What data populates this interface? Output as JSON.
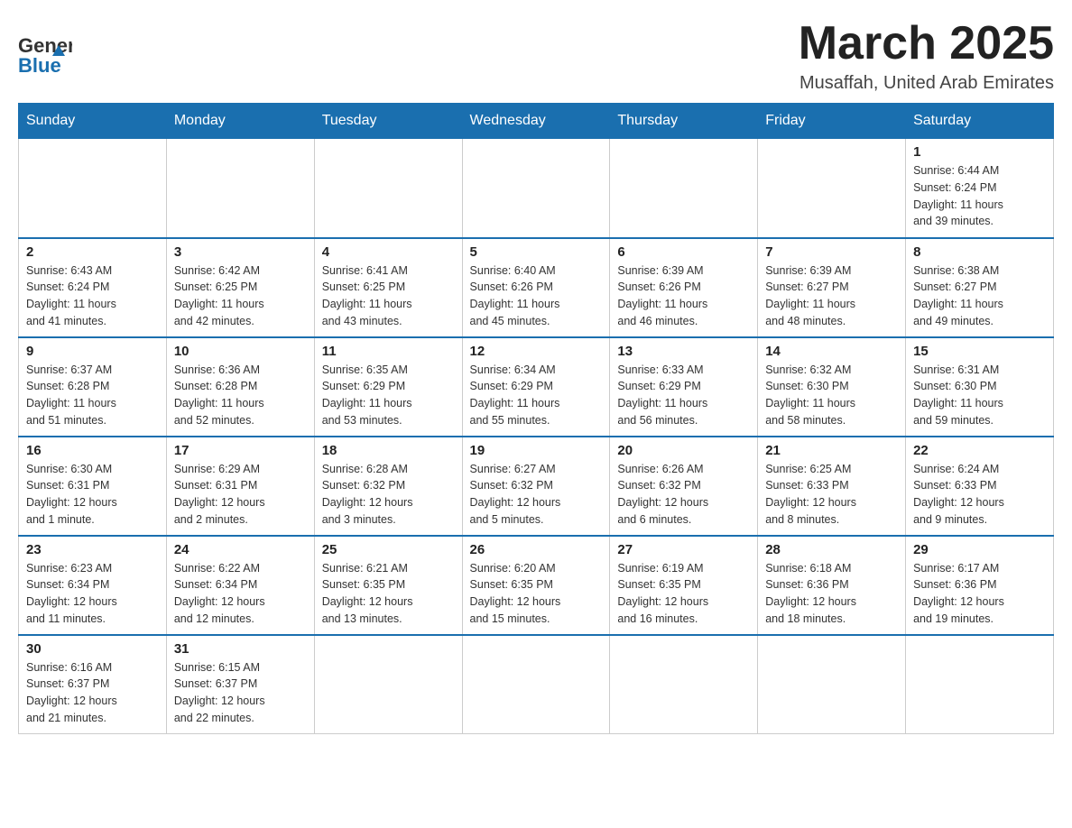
{
  "header": {
    "logo_line1": "General",
    "logo_line2": "Blue",
    "month_title": "March 2025",
    "location": "Musaffah, United Arab Emirates"
  },
  "days_of_week": [
    "Sunday",
    "Monday",
    "Tuesday",
    "Wednesday",
    "Thursday",
    "Friday",
    "Saturday"
  ],
  "weeks": [
    [
      {
        "day": "",
        "info": ""
      },
      {
        "day": "",
        "info": ""
      },
      {
        "day": "",
        "info": ""
      },
      {
        "day": "",
        "info": ""
      },
      {
        "day": "",
        "info": ""
      },
      {
        "day": "",
        "info": ""
      },
      {
        "day": "1",
        "info": "Sunrise: 6:44 AM\nSunset: 6:24 PM\nDaylight: 11 hours\nand 39 minutes."
      }
    ],
    [
      {
        "day": "2",
        "info": "Sunrise: 6:43 AM\nSunset: 6:24 PM\nDaylight: 11 hours\nand 41 minutes."
      },
      {
        "day": "3",
        "info": "Sunrise: 6:42 AM\nSunset: 6:25 PM\nDaylight: 11 hours\nand 42 minutes."
      },
      {
        "day": "4",
        "info": "Sunrise: 6:41 AM\nSunset: 6:25 PM\nDaylight: 11 hours\nand 43 minutes."
      },
      {
        "day": "5",
        "info": "Sunrise: 6:40 AM\nSunset: 6:26 PM\nDaylight: 11 hours\nand 45 minutes."
      },
      {
        "day": "6",
        "info": "Sunrise: 6:39 AM\nSunset: 6:26 PM\nDaylight: 11 hours\nand 46 minutes."
      },
      {
        "day": "7",
        "info": "Sunrise: 6:39 AM\nSunset: 6:27 PM\nDaylight: 11 hours\nand 48 minutes."
      },
      {
        "day": "8",
        "info": "Sunrise: 6:38 AM\nSunset: 6:27 PM\nDaylight: 11 hours\nand 49 minutes."
      }
    ],
    [
      {
        "day": "9",
        "info": "Sunrise: 6:37 AM\nSunset: 6:28 PM\nDaylight: 11 hours\nand 51 minutes."
      },
      {
        "day": "10",
        "info": "Sunrise: 6:36 AM\nSunset: 6:28 PM\nDaylight: 11 hours\nand 52 minutes."
      },
      {
        "day": "11",
        "info": "Sunrise: 6:35 AM\nSunset: 6:29 PM\nDaylight: 11 hours\nand 53 minutes."
      },
      {
        "day": "12",
        "info": "Sunrise: 6:34 AM\nSunset: 6:29 PM\nDaylight: 11 hours\nand 55 minutes."
      },
      {
        "day": "13",
        "info": "Sunrise: 6:33 AM\nSunset: 6:29 PM\nDaylight: 11 hours\nand 56 minutes."
      },
      {
        "day": "14",
        "info": "Sunrise: 6:32 AM\nSunset: 6:30 PM\nDaylight: 11 hours\nand 58 minutes."
      },
      {
        "day": "15",
        "info": "Sunrise: 6:31 AM\nSunset: 6:30 PM\nDaylight: 11 hours\nand 59 minutes."
      }
    ],
    [
      {
        "day": "16",
        "info": "Sunrise: 6:30 AM\nSunset: 6:31 PM\nDaylight: 12 hours\nand 1 minute."
      },
      {
        "day": "17",
        "info": "Sunrise: 6:29 AM\nSunset: 6:31 PM\nDaylight: 12 hours\nand 2 minutes."
      },
      {
        "day": "18",
        "info": "Sunrise: 6:28 AM\nSunset: 6:32 PM\nDaylight: 12 hours\nand 3 minutes."
      },
      {
        "day": "19",
        "info": "Sunrise: 6:27 AM\nSunset: 6:32 PM\nDaylight: 12 hours\nand 5 minutes."
      },
      {
        "day": "20",
        "info": "Sunrise: 6:26 AM\nSunset: 6:32 PM\nDaylight: 12 hours\nand 6 minutes."
      },
      {
        "day": "21",
        "info": "Sunrise: 6:25 AM\nSunset: 6:33 PM\nDaylight: 12 hours\nand 8 minutes."
      },
      {
        "day": "22",
        "info": "Sunrise: 6:24 AM\nSunset: 6:33 PM\nDaylight: 12 hours\nand 9 minutes."
      }
    ],
    [
      {
        "day": "23",
        "info": "Sunrise: 6:23 AM\nSunset: 6:34 PM\nDaylight: 12 hours\nand 11 minutes."
      },
      {
        "day": "24",
        "info": "Sunrise: 6:22 AM\nSunset: 6:34 PM\nDaylight: 12 hours\nand 12 minutes."
      },
      {
        "day": "25",
        "info": "Sunrise: 6:21 AM\nSunset: 6:35 PM\nDaylight: 12 hours\nand 13 minutes."
      },
      {
        "day": "26",
        "info": "Sunrise: 6:20 AM\nSunset: 6:35 PM\nDaylight: 12 hours\nand 15 minutes."
      },
      {
        "day": "27",
        "info": "Sunrise: 6:19 AM\nSunset: 6:35 PM\nDaylight: 12 hours\nand 16 minutes."
      },
      {
        "day": "28",
        "info": "Sunrise: 6:18 AM\nSunset: 6:36 PM\nDaylight: 12 hours\nand 18 minutes."
      },
      {
        "day": "29",
        "info": "Sunrise: 6:17 AM\nSunset: 6:36 PM\nDaylight: 12 hours\nand 19 minutes."
      }
    ],
    [
      {
        "day": "30",
        "info": "Sunrise: 6:16 AM\nSunset: 6:37 PM\nDaylight: 12 hours\nand 21 minutes."
      },
      {
        "day": "31",
        "info": "Sunrise: 6:15 AM\nSunset: 6:37 PM\nDaylight: 12 hours\nand 22 minutes."
      },
      {
        "day": "",
        "info": ""
      },
      {
        "day": "",
        "info": ""
      },
      {
        "day": "",
        "info": ""
      },
      {
        "day": "",
        "info": ""
      },
      {
        "day": "",
        "info": ""
      }
    ]
  ]
}
